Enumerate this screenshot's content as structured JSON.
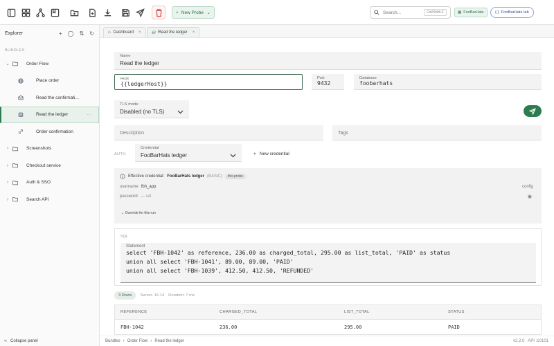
{
  "toolbar": {
    "new_probe_label": "New Probe",
    "search_placeholder": "Search...",
    "search_shortcut": "Ctrl/Shift+F",
    "workspace_label": "FooBarHats",
    "environment_label": "FooBarHats lab"
  },
  "sidebar": {
    "title": "Explorer",
    "section_label": "BUNDLES",
    "items": [
      {
        "label": "Order Flow",
        "type": "folder",
        "expanded": true
      },
      {
        "label": "Place order",
        "type": "leaf",
        "icon": "globe-icon"
      },
      {
        "label": "Read the confirmati...",
        "type": "leaf",
        "icon": "mail-icon"
      },
      {
        "label": "Read the ledger",
        "type": "leaf",
        "icon": "database-icon",
        "active": true
      },
      {
        "label": "Order confirmation",
        "type": "leaf",
        "icon": "link-icon"
      },
      {
        "label": "Screenshots",
        "type": "folder"
      },
      {
        "label": "Checkout service",
        "type": "folder"
      },
      {
        "label": "Auth & SSO",
        "type": "folder"
      },
      {
        "label": "Search API",
        "type": "folder"
      }
    ],
    "collapse_label": "Collapse panel"
  },
  "tabs": [
    {
      "label": "Dashboard"
    },
    {
      "label": "Read the ledger",
      "active": true
    }
  ],
  "form": {
    "name_label": "Name",
    "name_value": "Read the ledger",
    "host_label": "Host",
    "host_value": "{{ledgerHost}}",
    "port_label": "Port",
    "port_value": "9432",
    "database_label": "Database",
    "database_value": "foobarhats",
    "tls_label": "TLS mode",
    "tls_value": "Disabled (no TLS)",
    "description_placeholder": "Description",
    "tags_placeholder": "Tags"
  },
  "auth": {
    "section_label": "AUTH",
    "credential_label": "Credential",
    "credential_value": "FooBarHats ledger",
    "new_credential_label": "New credential",
    "effective_prefix": "Effective credential:",
    "effective_name": "FooBarHats ledger",
    "effective_type": "(BASIC)",
    "chip_label": "this probe",
    "username_key": "username",
    "username_value": "fbh_app",
    "config_label": "config",
    "password_key": "password",
    "password_value": "— set",
    "override_label": "Override for this run"
  },
  "sql": {
    "section_label": "SQL",
    "statement_label": "Statement",
    "lines": [
      "select 'FBH-1042' as reference, 236.00 as charged_total, 295.00 as list_total, 'PAID' as status",
      "union all select 'FBH-1041', 89.00, 89.00, 'PAID'",
      "union all select 'FBH-1039', 412.50, 412.50, 'REFUNDED'"
    ]
  },
  "results": {
    "rows_label": "3 Rows",
    "server_label": "Server: 16.14",
    "duration_label": "Duration: 7 ms",
    "columns": [
      "REFERENCE",
      "CHARGED_TOTAL",
      "LIST_TOTAL",
      "STATUS"
    ],
    "rows": [
      [
        "FBH-1042",
        "236.00",
        "295.00",
        "PAID"
      ]
    ]
  },
  "statusbar": {
    "breadcrumb": [
      "Bundles",
      "Order Flow",
      "Read the ledger"
    ],
    "version": "v2.2.0 · API :10101"
  },
  "colors": {
    "accent": "#2e7d51",
    "danger": "#d84b4b",
    "env_blue": "#2b4f9a"
  }
}
